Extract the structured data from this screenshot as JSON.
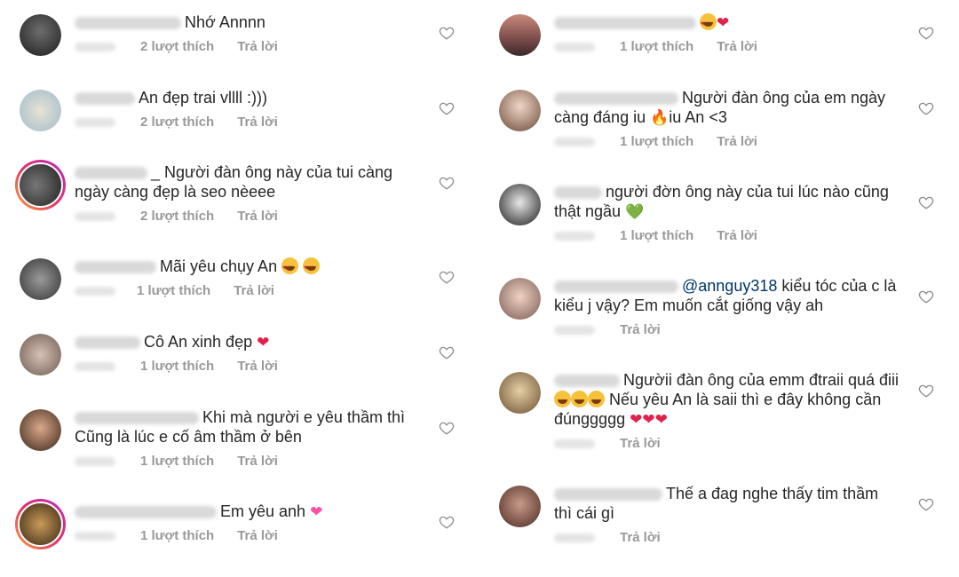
{
  "like_label": "lượt thích",
  "reply_label": "Trả lời",
  "left": [
    {
      "text": "Nhớ Annnn",
      "likes": "2",
      "emoji": "",
      "avatar": "#2b2b2b",
      "ring": false
    },
    {
      "text": "An đẹp trai vllll :)))",
      "likes": "2",
      "emoji": "",
      "avatar": "#9ab7c9",
      "ring": false
    },
    {
      "text": "_ Người đàn ông này của tui càng ngày càng đẹp là seo nèeee",
      "likes": "2",
      "emoji": "",
      "avatar": "#3a3a3a",
      "ring": true
    },
    {
      "text": "Mãi yêu chụy An",
      "likes": "1",
      "emoji": "😍😍",
      "avatar": "#4a4a4a",
      "ring": false
    },
    {
      "text": "Cô An xinh đẹp",
      "likes": "1",
      "emoji": "❤",
      "avatar": "#b89a8a",
      "ring": false
    },
    {
      "text": "Khi mà người e yêu thầm thì Cũng là lúc e cố âm thầm ở bên",
      "likes": "1",
      "emoji": "",
      "avatar": "#8a5a3a",
      "ring": false
    },
    {
      "text": "Em yêu anh",
      "likes": "1",
      "emoji": "💗",
      "avatar": "#7a5a30",
      "ring": true
    }
  ],
  "right": [
    {
      "text": "",
      "likes": "1",
      "emoji": "😍❤",
      "avatar": "#8a5a5a"
    },
    {
      "text": "Người đàn ông của em ngày càng đáng iu",
      "text2": "iu An <3",
      "likes": "1",
      "emoji": "🔥",
      "avatar": "#d9b8a0"
    },
    {
      "text": "người đờn ông này của tui lúc nào cũng thật ngầu",
      "likes": "1",
      "emoji": "💚",
      "avatar": "#2e2e2e"
    },
    {
      "mention": "@annguy318",
      "text": "kiểu tóc của c là kiểu j vậy? Em muốn cắt giống vậy ah",
      "likes": "",
      "emoji": "",
      "avatar": "#c9a79a"
    },
    {
      "text": "Ngườii đàn ông của emm đtraii quá điii",
      "text2": "Nếu yêu An là saii thì e đây không cần đúnggggg",
      "likes": "",
      "emoji": "😆😆😆",
      "emoji2": "❤❤❤",
      "avatar": "#a08060"
    },
    {
      "text": "Thế a đag nghe thấy tim thầm thì cái gì",
      "likes": "",
      "emoji": "",
      "avatar": "#6a4a3a"
    }
  ]
}
